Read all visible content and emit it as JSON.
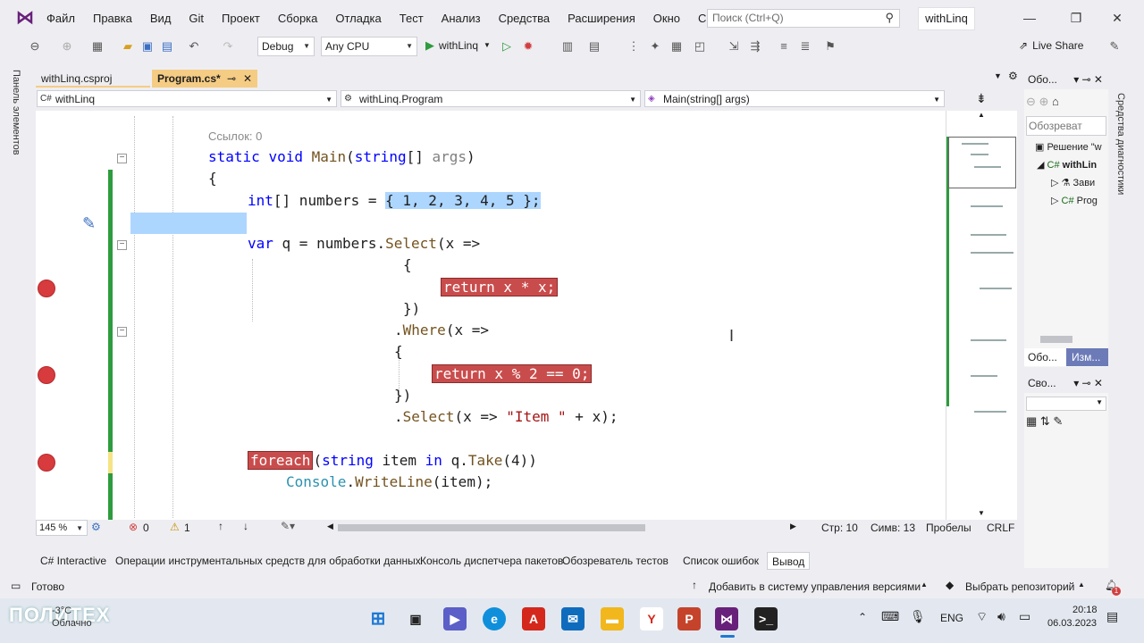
{
  "app": {
    "menu": [
      "Файл",
      "Правка",
      "Вид",
      "Git",
      "Проект",
      "Сборка",
      "Отладка",
      "Тест",
      "Анализ",
      "Средства",
      "Расширения",
      "Окно",
      "Справка"
    ],
    "search_placeholder": "Поиск (Ctrl+Q)",
    "solution_name": "withLinq"
  },
  "toolbar": {
    "config": "Debug",
    "platform": "Any CPU",
    "run_label": "withLinq",
    "live_share": "Live Share"
  },
  "left_strip": {
    "label": "Панель элементов"
  },
  "right_strip": {
    "label": "Средства диагностики"
  },
  "tabs": {
    "tab1": "withLinq.csproj",
    "tab2": "Program.cs*"
  },
  "navbar": {
    "project": "withLinq",
    "class": "withLinq.Program",
    "member": "Main(string[] args)"
  },
  "code": {
    "refs": "Ссылок: 0",
    "l1_kw1": "static",
    "l1_kw2": "void",
    "l1_name": "Main",
    "l1_rest": "(",
    "l1_type": "string",
    "l1_rest2": "[] ",
    "l1_arg": "args",
    "l1_end": ")",
    "l2": "{",
    "l3_kw": "int",
    "l3_mid": "[] numbers = ",
    "l3_sel": "{ 1, 2, 3, 4, 5 };",
    "l4_kw": "var",
    "l4_mid": " q = numbers.",
    "l4_mt": "Select",
    "l4_end": "(x =>",
    "l5": "{",
    "l6": "return x * x;",
    "l7": "})",
    "l8_dot": ".",
    "l8_mt": "Where",
    "l8_end": "(x =>",
    "l9": "{",
    "l10": "return x % 2 == 0;",
    "l11": "})",
    "l12_dot": ".",
    "l12_mt": "Select",
    "l12_mid": "(x => ",
    "l12_str": "\"Item \"",
    "l12_end": " + x);",
    "l13_kw": "foreach",
    "l13_a": "(",
    "l13_type": "string",
    "l13_b": " item ",
    "l13_in": "in",
    "l13_c": " q.",
    "l13_mt": "Take",
    "l13_d": "(4))",
    "l14_cls": "Console",
    "l14_dot": ".",
    "l14_mt": "WriteLine",
    "l14_end": "(item);"
  },
  "editor_status": {
    "zoom": "145 %",
    "errors": "0",
    "warnings": "1",
    "line": "Стр: 10",
    "col": "Симв: 13",
    "spaces": "Пробелы",
    "eol": "CRLF"
  },
  "bottom_tabs": [
    "C# Interactive",
    "Операции инструментальных средств для обработки данных",
    "Консоль диспетчера пакетов",
    "Обозреватель тестов",
    "Список ошибок",
    "Вывод"
  ],
  "solution_explorer": {
    "title": "Обо...",
    "search": "Обозреват",
    "solution": "Решение \"w",
    "project": "withLin",
    "deps": "Зави",
    "prog": "Prog",
    "tab_a": "Обо...",
    "tab_b": "Изм..."
  },
  "properties": {
    "title": "Сво..."
  },
  "statusbar": {
    "ready": "Готово",
    "add_vcs": "Добавить в систему управления версиями",
    "repo": "Выбрать репозиторий",
    "notif": "1"
  },
  "taskbar": {
    "weather_temp": "-3°C",
    "weather": "Облачно",
    "lang": "ENG",
    "time": "20:18",
    "date": "06.03.2023",
    "watermark": "ПОЛИТЕХ"
  }
}
